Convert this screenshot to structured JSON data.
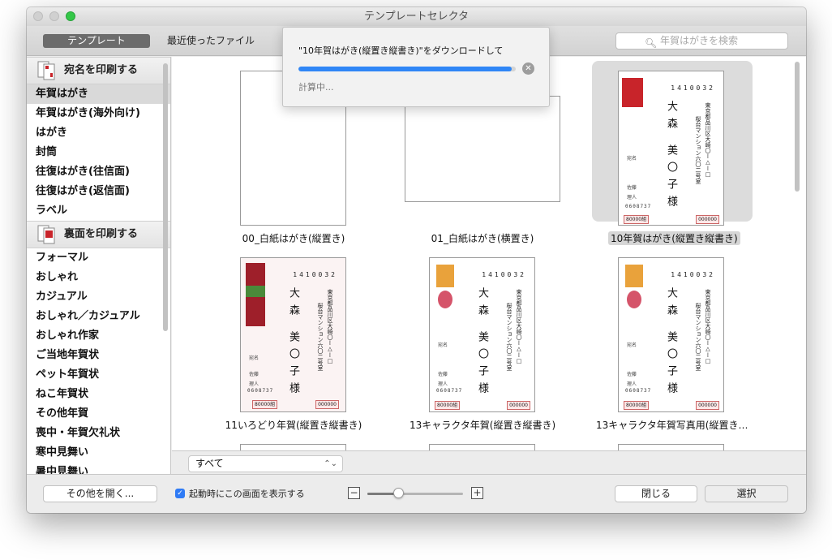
{
  "window": {
    "title": "テンプレートセレクタ"
  },
  "toolbar": {
    "tab_template": "テンプレート",
    "tab_recent": "最近使ったファイル",
    "search_placeholder": "年賀はがきを検索"
  },
  "sidebar": {
    "section1": {
      "label": "宛名を印刷する",
      "icon": "address-card-icon"
    },
    "section1_items": [
      "年賀はがき",
      "年賀はがき(海外向け)",
      "はがき",
      "封筒",
      "往復はがき(往信面)",
      "往復はがき(返信面)",
      "ラベル"
    ],
    "section2": {
      "label": "裏面を印刷する",
      "icon": "postcard-back-icon"
    },
    "section2_items": [
      "フォーマル",
      "おしゃれ",
      "カジュアル",
      "おしゃれ／カジュアル",
      "おしゃれ作家",
      "ご当地年賀状",
      "ペット年賀状",
      "ねこ年賀状",
      "その他年賀",
      "喪中・年賀欠礼状",
      "寒中見舞い",
      "暑中見舞い"
    ],
    "selected": "年賀はがき"
  },
  "templates": [
    {
      "caption": "00_白紙はがき(縦置き)"
    },
    {
      "caption": "01_白紙はがき(横置き)"
    },
    {
      "caption": "10年賀はがき(縦置き縦書き)"
    },
    {
      "caption": "11いろどり年賀(縦置き縦書き)"
    },
    {
      "caption": "13キャラクタ年賀(縦置き縦書き)"
    },
    {
      "caption": "13キャラクタ年賀写真用(縦置き…"
    }
  ],
  "postcard": {
    "zip": "1410032",
    "name1": "大森",
    "name2": "美〇子様",
    "address": "東京都品川区大崎〇ー△ー□",
    "building": "桜台マンション六〇二号室",
    "sender_zip": "0608737",
    "side1": "宛名",
    "side2": "佐藤",
    "side3": "理人",
    "price": "80000組",
    "price2": "000000",
    "tiny": "〇〇〇〇〇〇〇〇〇〇〇〇〇〇"
  },
  "filter": {
    "value": "すべて"
  },
  "footer": {
    "open_other": "その他を開く...",
    "show_at_startup": "起動時にこの画面を表示する",
    "close": "閉じる",
    "select": "選択",
    "zoom_level": 0.32
  },
  "download": {
    "title": "\"10年賀はがき(縦置き縦書き)\"をダウンロードして",
    "status": "計算中...",
    "progress": 0.98
  },
  "colors": {
    "accent": "#2f86f6",
    "postcard_red": "#c8242a"
  }
}
